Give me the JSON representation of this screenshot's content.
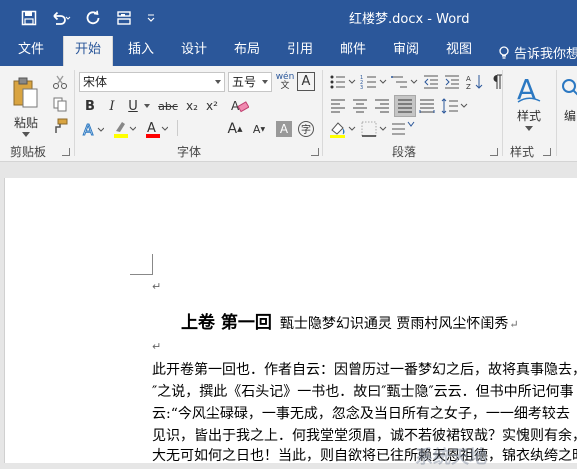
{
  "title_bar": {
    "doc_title": "红楼梦.docx - Word",
    "qat": [
      {
        "name": "save-icon"
      },
      {
        "name": "undo-icon"
      },
      {
        "name": "redo-icon"
      },
      {
        "name": "customize-icon"
      }
    ]
  },
  "tabs": [
    {
      "label": "文件"
    },
    {
      "label": "开始"
    },
    {
      "label": "插入"
    },
    {
      "label": "设计"
    },
    {
      "label": "布局"
    },
    {
      "label": "引用"
    },
    {
      "label": "邮件"
    },
    {
      "label": "审阅"
    },
    {
      "label": "视图"
    }
  ],
  "tell_me": "告诉我你想",
  "ribbon": {
    "clipboard": {
      "label": "剪贴板",
      "paste_label": "粘贴"
    },
    "font": {
      "label": "字体",
      "font_name": "宋体",
      "font_size": "五号",
      "wen_label": "wén",
      "A_label": "A",
      "bold": "B",
      "italic": "I",
      "underline": "U",
      "strike": "abc",
      "sub": "x₂",
      "sup": "x²",
      "grow": "A",
      "shrink": "A",
      "aa": "Aa",
      "shade_a": "A",
      "circle": "字"
    },
    "paragraph": {
      "label": "段落"
    },
    "styles": {
      "label": "样式",
      "button_label": "样式"
    },
    "editing": {
      "button_label": "编"
    },
    "colors": {
      "accent": "#2b579a",
      "highlight": "#ffff00",
      "font_color": "#ff0000"
    }
  },
  "document": {
    "heading_main": "上卷  第一回",
    "heading_sub": "甄士隐梦幻识通灵    贾雨村风尘怀闺秀",
    "lines": [
      "此开卷第一回也．作者自云：因曾历过一番梦幻之后，故将真事隐去，",
      "″之说，撰此《石头记》一书也．故曰″甄士隐″云云．但书中所记何事",
      "云:“今风尘碌碌，一事无成，忽念及当日所有之女子，一一细考较去",
      "见识，皆出于我之上．何我堂堂须眉，诚不若彼裙钗哉？实愧则有余，",
      "大无可如何之日也！当此，则自欲将已往所赖天恩祖德，锦衣纨绔之时"
    ],
    "para_mark": "↵",
    "watermark": "系统天地"
  }
}
